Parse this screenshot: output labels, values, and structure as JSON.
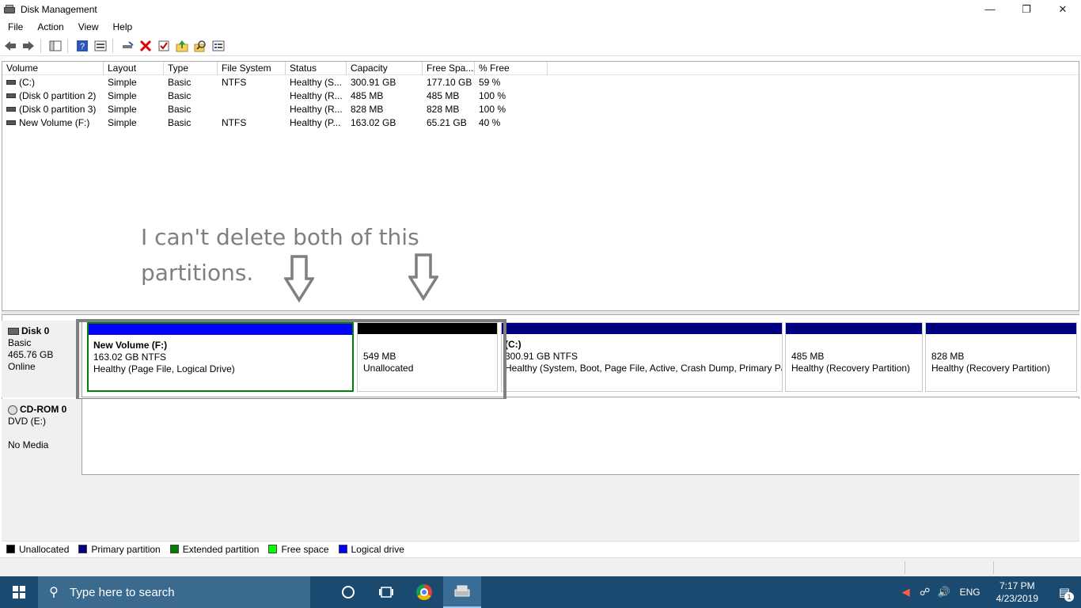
{
  "window": {
    "title": "Disk Management"
  },
  "menu": [
    "File",
    "Action",
    "View",
    "Help"
  ],
  "toolbar": {
    "icons": [
      "back-arrow-icon",
      "forward-arrow-icon",
      "console-tree-icon",
      "help-icon",
      "properties-icon",
      "connect-drive-icon",
      "delete-icon",
      "check-icon",
      "import-icon",
      "search-icon",
      "list-icon"
    ]
  },
  "volume_list": {
    "columns": [
      "Volume",
      "Layout",
      "Type",
      "File System",
      "Status",
      "Capacity",
      "Free Spa...",
      "% Free"
    ],
    "rows": [
      [
        "(C:)",
        "Simple",
        "Basic",
        "NTFS",
        "Healthy (S...",
        "300.91 GB",
        "177.10 GB",
        "59 %"
      ],
      [
        "(Disk 0 partition 2)",
        "Simple",
        "Basic",
        "",
        "Healthy (R...",
        "485 MB",
        "485 MB",
        "100 %"
      ],
      [
        "(Disk 0 partition 3)",
        "Simple",
        "Basic",
        "",
        "Healthy (R...",
        "828 MB",
        "828 MB",
        "100 %"
      ],
      [
        "New Volume (F:)",
        "Simple",
        "Basic",
        "NTFS",
        "Healthy (P...",
        "163.02 GB",
        "65.21 GB",
        "40 %"
      ]
    ]
  },
  "annotation": {
    "line1": "I can't delete both of this",
    "line2": "partitions."
  },
  "disks": [
    {
      "name": "Disk 0",
      "type": "Basic",
      "size": "465.76 GB",
      "status": "Online",
      "partitions": [
        {
          "title": "New Volume  (F:)",
          "size": "163.02 GB NTFS",
          "status": "Healthy (Page File, Logical Drive)",
          "bar_color": "#0000ff"
        },
        {
          "title": "",
          "size": "549 MB",
          "status": "Unallocated",
          "bar_color": "#000000"
        },
        {
          "title": "(C:)",
          "size": "300.91 GB NTFS",
          "status": "Healthy (System, Boot, Page File, Active, Crash Dump, Primary Pa",
          "bar_color": "#000080"
        },
        {
          "title": "",
          "size": "485 MB",
          "status": "Healthy (Recovery Partition)",
          "bar_color": "#000080"
        },
        {
          "title": "",
          "size": "828 MB",
          "status": "Healthy (Recovery Partition)",
          "bar_color": "#000080"
        }
      ]
    },
    {
      "name": "CD-ROM 0",
      "type": "DVD (E:)",
      "status": "No Media"
    }
  ],
  "legend": [
    {
      "label": "Unallocated",
      "color": "#000000"
    },
    {
      "label": "Primary partition",
      "color": "#000080"
    },
    {
      "label": "Extended partition",
      "color": "#008000"
    },
    {
      "label": "Free space",
      "color": "#00ff00"
    },
    {
      "label": "Logical drive",
      "color": "#0000ff"
    }
  ],
  "taskbar": {
    "search_placeholder": "Type here to search",
    "language": "ENG",
    "time": "7:17 PM",
    "date": "4/23/2019",
    "notification_count": "1"
  }
}
